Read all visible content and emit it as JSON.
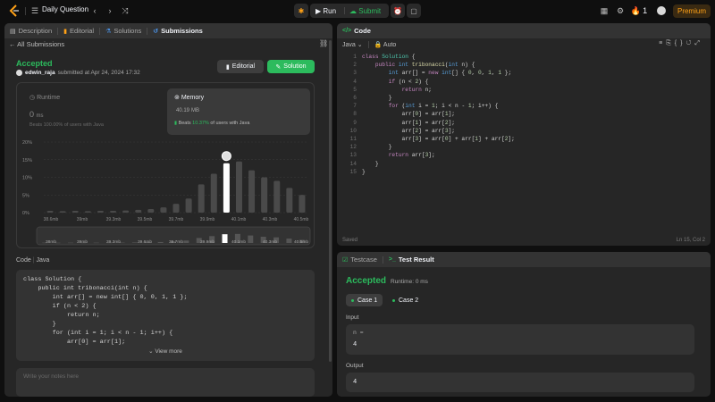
{
  "topnav": {
    "title": "Daily Question",
    "run_label": "Run",
    "submit_label": "Submit",
    "streak": "1",
    "premium_label": "Premium"
  },
  "left": {
    "tabs": [
      {
        "label": "Description"
      },
      {
        "label": "Editorial"
      },
      {
        "label": "Solutions"
      },
      {
        "label": "Submissions"
      }
    ],
    "all_submissions": "All Submissions",
    "status": "Accepted",
    "user": "edwin_raja",
    "submitted_text": "submitted at Apr 24, 2024 17:32",
    "editorial_btn": "Editorial",
    "solution_btn": "Solution",
    "runtime": {
      "title": "Runtime",
      "value": "0",
      "unit": "ms",
      "beats_prefix": "Beats",
      "beats_pct": "100.00%",
      "beats_suffix": "of users with Java"
    },
    "memory": {
      "title": "Memory",
      "value": "40.19",
      "unit": "MB",
      "beats_prefix": "Beats",
      "beats_pct": "10.37%",
      "beats_suffix": "of users with Java"
    },
    "code_header": "Code",
    "code_lang": "Java",
    "code_lines": [
      "class Solution {",
      "    public int tribonacci(int n) {",
      "        int arr[] = new int[] { 0, 0, 1, 1 };",
      "        if (n < 2) {",
      "            return n;",
      "        }",
      "        for (int i = 1; i < n - 1; i++) {",
      "            arr[0] = arr[1];"
    ],
    "view_more": "View more",
    "notes_placeholder": "Write your notes here"
  },
  "chart_data": {
    "type": "bar",
    "y_ticks": [
      "20%",
      "15%",
      "10%",
      "5%",
      "0%"
    ],
    "ylim": [
      0,
      20
    ],
    "x_labels": [
      "38.6mb",
      "39mb",
      "39.3mb",
      "39.5mb",
      "39.7mb",
      "39.9mb",
      "40.1mb",
      "40.3mb",
      "40.5mb"
    ],
    "minimap_labels": [
      "38mb",
      "39mb",
      "39.3mb",
      "39.6mb",
      "39.7mb",
      "39.9mb",
      "40.1mb",
      "40.3mb",
      "40.5mb"
    ],
    "values": [
      0.5,
      0.4,
      0.5,
      0.4,
      0.5,
      0.5,
      0.6,
      0.8,
      1,
      1.5,
      2.5,
      4,
      8,
      11,
      14,
      14.5,
      12,
      10,
      9,
      7,
      5
    ],
    "highlight_index": 14
  },
  "editor": {
    "tab_label": "Code",
    "language": "Java",
    "mode": "Auto",
    "status_left": "Saved",
    "status_right": "Ln 15, Col 2",
    "line_numbers": [
      "1",
      "2",
      "3",
      "4",
      "5",
      "6",
      "7",
      "8",
      "9",
      "10",
      "11",
      "12",
      "13",
      "14",
      "15"
    ]
  },
  "result": {
    "tabs": [
      {
        "label": "Testcase"
      },
      {
        "label": "Test Result"
      }
    ],
    "status": "Accepted",
    "runtime": "Runtime: 0 ms",
    "cases": [
      "Case 1",
      "Case 2"
    ],
    "input_label": "Input",
    "input_name": "n =",
    "input_value": "4",
    "output_label": "Output",
    "output_value": "4"
  }
}
